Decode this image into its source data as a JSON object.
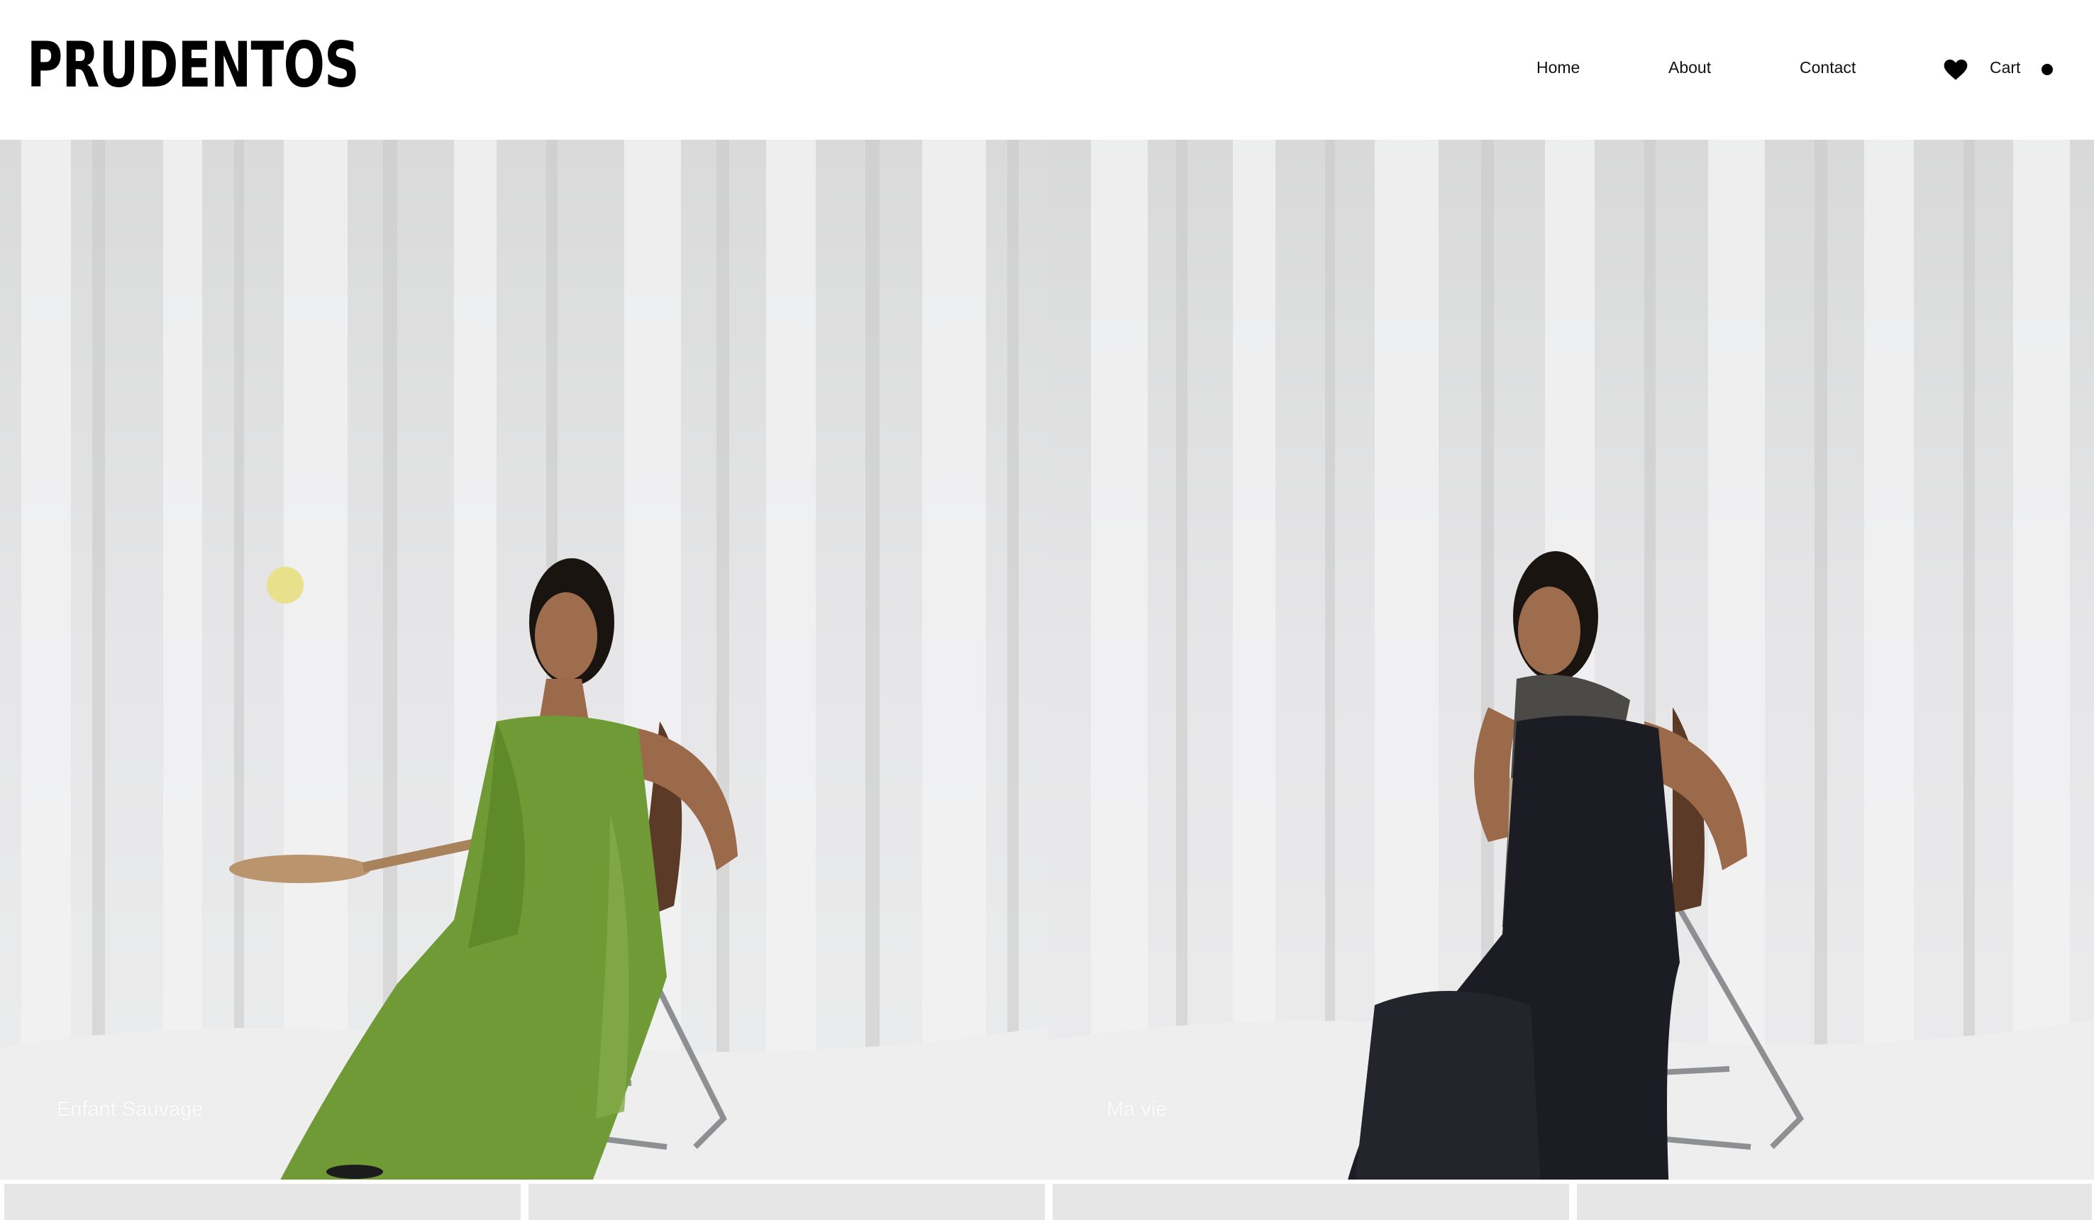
{
  "header": {
    "logo": "PRUDENTOS",
    "nav": [
      {
        "label": "Home"
      },
      {
        "label": "About"
      },
      {
        "label": "Contact"
      }
    ],
    "wishlist_icon": "heart-icon",
    "cart_label": "Cart",
    "cart_indicator_icon": "dot-icon"
  },
  "hero": [
    {
      "caption": "Enfant Sauvage"
    },
    {
      "caption": "Ma vie"
    }
  ],
  "colors": {
    "background": "#ffffff",
    "text": "#111111",
    "backdrop": "#e4e4e6",
    "green_dress": "#6f9a35",
    "black_dress": "#1c1d24"
  }
}
